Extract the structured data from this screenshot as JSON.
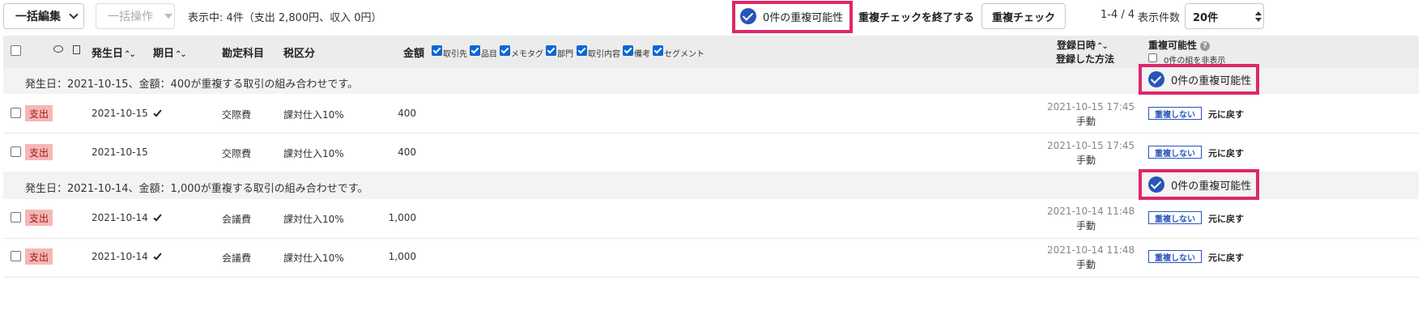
{
  "toolbar": {
    "bulk_edit_label": "一括編集",
    "bulk_action_label": "一括操作",
    "display_summary": "表示中: 4件（支出 2,800円、収入 0円）",
    "dup_possibility_label": "0件の重複可能性",
    "end_dup_check_label": "重複チェックを終了する",
    "dup_check_label": "重複チェック",
    "pagination": "1-4 / 4",
    "per_page_label": "表示件数",
    "per_page_value": "20件"
  },
  "header": {
    "date": "発生日",
    "due": "期日",
    "account": "勘定科目",
    "tax": "税区分",
    "amount": "金額",
    "filters": [
      "取引先",
      "品目",
      "メモタグ",
      "部門",
      "取引内容",
      "備考",
      "セグメント"
    ],
    "registered_at": "登録日時",
    "registered_method": "登録した方法",
    "dup_possibility": "重複可能性",
    "hide_zero_groups": "0件の組を非表示",
    "help_icon": "?"
  },
  "groups": [
    {
      "message": "発生日：2021-10-15、金額：400が重複する取引の組み合わせです。",
      "dup_label": "0件の重複可能性",
      "rows": [
        {
          "type": "支出",
          "date": "2021-10-15",
          "account": "交際費",
          "tax": "課対仕入10%",
          "amount": "400",
          "reg_time": "2021-10-15 17:45",
          "method": "手動",
          "nodup": "重複しない",
          "revert": "元に戻す"
        },
        {
          "type": "支出",
          "date": "2021-10-15",
          "account": "交際費",
          "tax": "課対仕入10%",
          "amount": "400",
          "reg_time": "2021-10-15 17:45",
          "method": "手動",
          "nodup": "重複しない",
          "revert": "元に戻す"
        }
      ]
    },
    {
      "message": "発生日：2021-10-14、金額：1,000が重複する取引の組み合わせです。",
      "dup_label": "0件の重複可能性",
      "rows": [
        {
          "type": "支出",
          "date": "2021-10-14",
          "account": "会議費",
          "tax": "課対仕入10%",
          "amount": "1,000",
          "reg_time": "2021-10-14 11:48",
          "method": "手動",
          "nodup": "重複しない",
          "revert": "元に戻す"
        },
        {
          "type": "支出",
          "date": "2021-10-14",
          "account": "会議費",
          "tax": "課対仕入10%",
          "amount": "1,000",
          "reg_time": "2021-10-14 11:48",
          "method": "手動",
          "nodup": "重複しない",
          "revert": "元に戻す"
        }
      ]
    }
  ],
  "colors": {
    "accent": "#2955b8",
    "highlight": "#e0266a",
    "expense_bg": "#f5b7b5",
    "expense_text": "#a01818"
  }
}
